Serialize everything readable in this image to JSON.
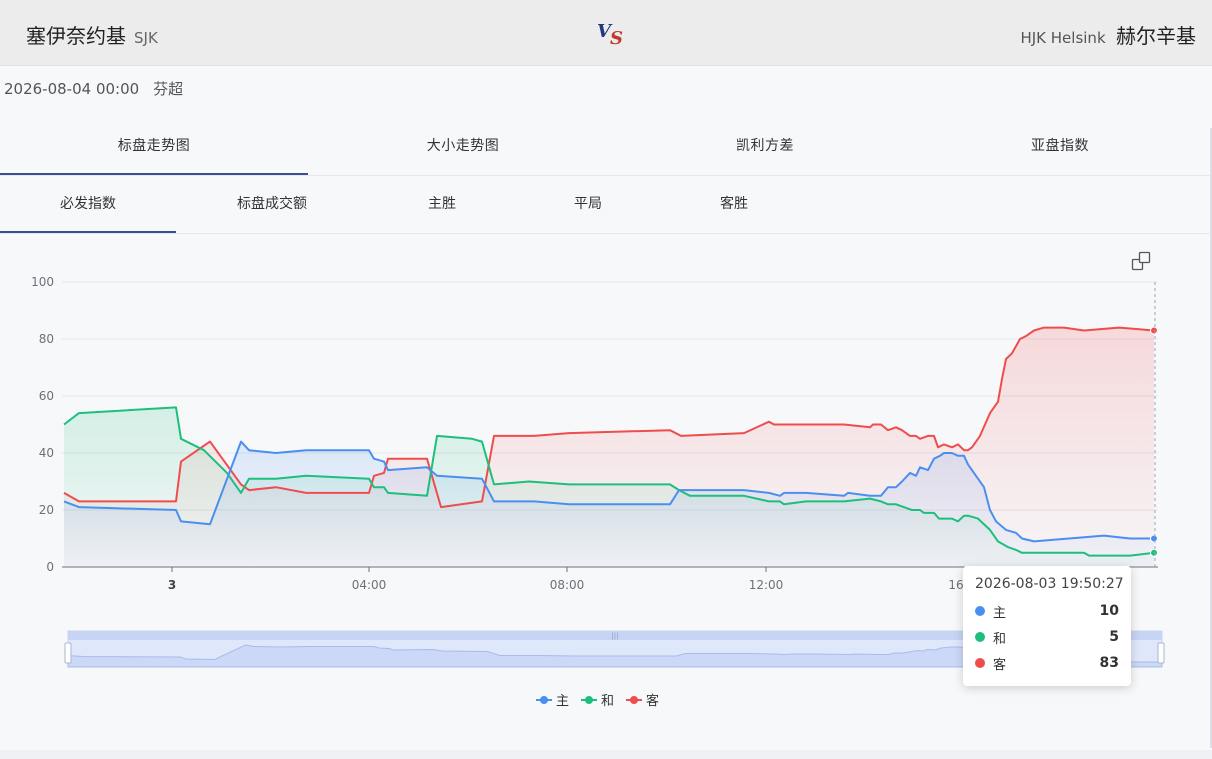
{
  "match": {
    "home_name": "塞伊奈约基",
    "home_abbr": "SJK",
    "away_en": "HJK Helsink",
    "away_name": "赫尔辛基",
    "datetime": "2026-08-04 00:00",
    "league": "芬超"
  },
  "tabs_primary": [
    {
      "label": "标盘走势图",
      "active": true
    },
    {
      "label": "大小走势图",
      "active": false
    },
    {
      "label": "凯利方差",
      "active": false
    },
    {
      "label": "亚盘指数",
      "active": false
    }
  ],
  "tabs_secondary": [
    {
      "label": "必发指数",
      "active": true
    },
    {
      "label": "标盘成交额",
      "active": false
    },
    {
      "label": "主胜",
      "active": false
    },
    {
      "label": "平局",
      "active": false
    },
    {
      "label": "客胜",
      "active": false
    }
  ],
  "tooltip": {
    "time": "2026-08-03 19:50:27",
    "rows": [
      {
        "name": "主",
        "value": "10",
        "color": "#4a8ff0"
      },
      {
        "name": "和",
        "value": "5",
        "color": "#1dbf7c"
      },
      {
        "name": "客",
        "value": "83",
        "color": "#ef4c4c"
      }
    ]
  },
  "toolbox_icon": "restore-icon",
  "chart_data": {
    "type": "line",
    "y_ticks": [
      "0",
      "20",
      "40",
      "60",
      "80",
      "100"
    ],
    "ylim": [
      0,
      100
    ],
    "x_ticks": [
      "3",
      "04:00",
      "08:00",
      "12:00",
      "16:"
    ],
    "grid": true,
    "legend_position": "bottom",
    "colors": {
      "主": "#4a8ff0",
      "和": "#1dbf7c",
      "客": "#ef4c4c"
    },
    "series": [
      {
        "name": "主",
        "points": [
          [
            0,
            23
          ],
          [
            15,
            21
          ],
          [
            112,
            20
          ],
          [
            117,
            16
          ],
          [
            146,
            15
          ],
          [
            177,
            44
          ],
          [
            185,
            41
          ],
          [
            212,
            40
          ],
          [
            242,
            41
          ],
          [
            305,
            41
          ],
          [
            310,
            38
          ],
          [
            320,
            37
          ],
          [
            324,
            34
          ],
          [
            363,
            35
          ],
          [
            373,
            32
          ],
          [
            418,
            31
          ],
          [
            430,
            23
          ],
          [
            470,
            23
          ],
          [
            505,
            22
          ],
          [
            606,
            22
          ],
          [
            615,
            27
          ],
          [
            680,
            27
          ],
          [
            705,
            26
          ],
          [
            716,
            25
          ],
          [
            720,
            26
          ],
          [
            742,
            26
          ],
          [
            780,
            25
          ],
          [
            784,
            26
          ],
          [
            806,
            25
          ],
          [
            817,
            25
          ],
          [
            824,
            28
          ],
          [
            832,
            28
          ],
          [
            838,
            30
          ],
          [
            846,
            33
          ],
          [
            852,
            32
          ],
          [
            856,
            35
          ],
          [
            864,
            34
          ],
          [
            870,
            38
          ],
          [
            876,
            39
          ],
          [
            880,
            40
          ],
          [
            888,
            40
          ],
          [
            894,
            39
          ],
          [
            900,
            39
          ],
          [
            904,
            36
          ],
          [
            914,
            31
          ],
          [
            920,
            28
          ],
          [
            926,
            20
          ],
          [
            932,
            16
          ],
          [
            942,
            13
          ],
          [
            952,
            12
          ],
          [
            958,
            10
          ],
          [
            970,
            9
          ],
          [
            1040,
            11
          ],
          [
            1066,
            10
          ],
          [
            1090,
            10
          ]
        ]
      },
      {
        "name": "和",
        "points": [
          [
            0,
            50
          ],
          [
            15,
            54
          ],
          [
            112,
            56
          ],
          [
            117,
            45
          ],
          [
            140,
            41
          ],
          [
            163,
            33
          ],
          [
            177,
            26
          ],
          [
            185,
            31
          ],
          [
            212,
            31
          ],
          [
            242,
            32
          ],
          [
            305,
            31
          ],
          [
            310,
            28
          ],
          [
            320,
            28
          ],
          [
            324,
            26
          ],
          [
            363,
            25
          ],
          [
            373,
            46
          ],
          [
            408,
            45
          ],
          [
            418,
            44
          ],
          [
            430,
            29
          ],
          [
            465,
            30
          ],
          [
            505,
            29
          ],
          [
            606,
            29
          ],
          [
            615,
            27
          ],
          [
            626,
            25
          ],
          [
            675,
            25
          ],
          [
            680,
            25
          ],
          [
            705,
            23
          ],
          [
            716,
            23
          ],
          [
            720,
            22
          ],
          [
            742,
            23
          ],
          [
            780,
            23
          ],
          [
            806,
            24
          ],
          [
            817,
            23
          ],
          [
            824,
            22
          ],
          [
            832,
            22
          ],
          [
            848,
            20
          ],
          [
            856,
            20
          ],
          [
            860,
            19
          ],
          [
            870,
            19
          ],
          [
            875,
            17
          ],
          [
            888,
            17
          ],
          [
            894,
            16
          ],
          [
            900,
            18
          ],
          [
            904,
            18
          ],
          [
            914,
            17
          ],
          [
            926,
            13
          ],
          [
            934,
            9
          ],
          [
            944,
            7
          ],
          [
            952,
            6
          ],
          [
            958,
            5
          ],
          [
            1020,
            5
          ],
          [
            1025,
            4
          ],
          [
            1066,
            4
          ],
          [
            1090,
            5
          ]
        ]
      },
      {
        "name": "客",
        "points": [
          [
            0,
            26
          ],
          [
            15,
            23
          ],
          [
            112,
            23
          ],
          [
            117,
            37
          ],
          [
            146,
            44
          ],
          [
            177,
            29
          ],
          [
            185,
            27
          ],
          [
            212,
            28
          ],
          [
            242,
            26
          ],
          [
            305,
            26
          ],
          [
            310,
            32
          ],
          [
            320,
            33
          ],
          [
            324,
            38
          ],
          [
            363,
            38
          ],
          [
            377,
            21
          ],
          [
            418,
            23
          ],
          [
            430,
            46
          ],
          [
            470,
            46
          ],
          [
            505,
            47
          ],
          [
            606,
            48
          ],
          [
            617,
            46
          ],
          [
            680,
            47
          ],
          [
            705,
            51
          ],
          [
            710,
            50
          ],
          [
            742,
            50
          ],
          [
            780,
            50
          ],
          [
            806,
            49
          ],
          [
            809,
            50
          ],
          [
            817,
            50
          ],
          [
            824,
            48
          ],
          [
            832,
            49
          ],
          [
            838,
            48
          ],
          [
            846,
            46
          ],
          [
            852,
            46
          ],
          [
            856,
            45
          ],
          [
            864,
            46
          ],
          [
            870,
            46
          ],
          [
            874,
            42
          ],
          [
            880,
            43
          ],
          [
            888,
            42
          ],
          [
            894,
            43
          ],
          [
            900,
            41
          ],
          [
            904,
            41
          ],
          [
            908,
            42
          ],
          [
            916,
            46
          ],
          [
            926,
            54
          ],
          [
            934,
            58
          ],
          [
            938,
            66
          ],
          [
            942,
            73
          ],
          [
            948,
            75
          ],
          [
            956,
            80
          ],
          [
            962,
            81
          ],
          [
            970,
            83
          ],
          [
            980,
            84
          ],
          [
            1000,
            84
          ],
          [
            1020,
            83
          ],
          [
            1055,
            84
          ],
          [
            1090,
            83
          ]
        ]
      }
    ]
  },
  "legend": [
    {
      "name": "主",
      "color": "#4a8ff0"
    },
    {
      "name": "和",
      "color": "#1dbf7c"
    },
    {
      "name": "客",
      "color": "#ef4c4c"
    }
  ]
}
